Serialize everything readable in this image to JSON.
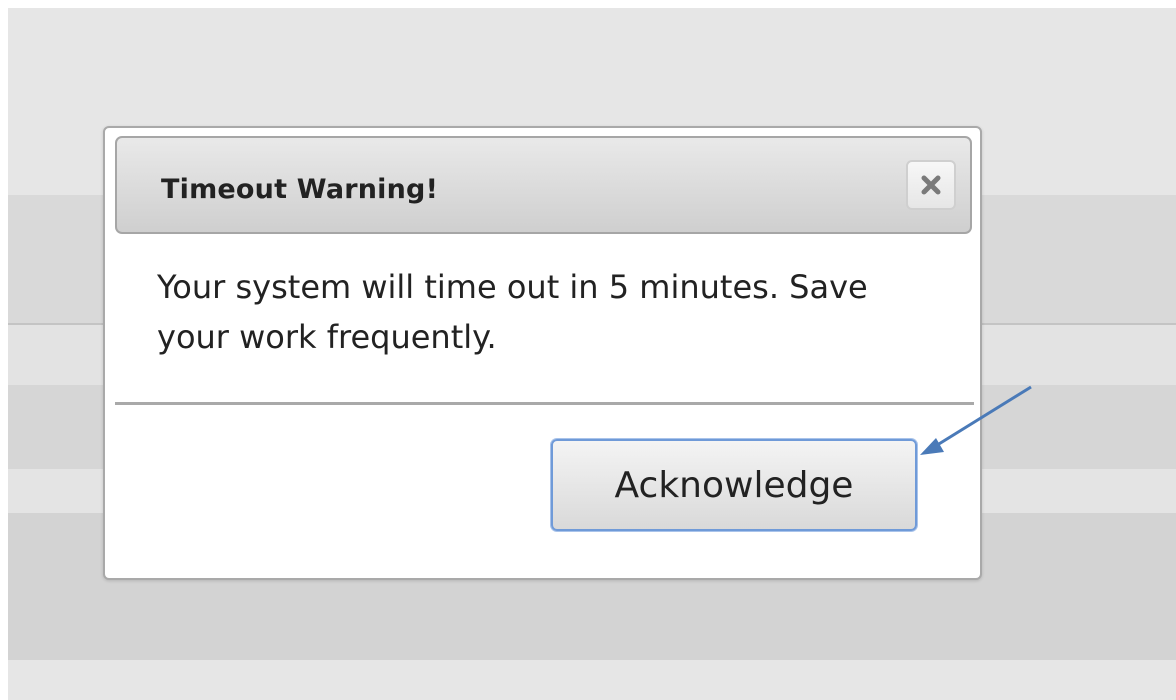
{
  "dialog": {
    "title": "Timeout Warning!",
    "close_icon": "close-x-icon",
    "message": "Your system will time out in 5 minutes. Save your work frequently.",
    "acknowledge_label": "Acknowledge"
  },
  "colors": {
    "button_focus_border": "#6f9ad8",
    "annotation_arrow": "#4a7ab8",
    "backdrop": "#e6e6e6"
  }
}
